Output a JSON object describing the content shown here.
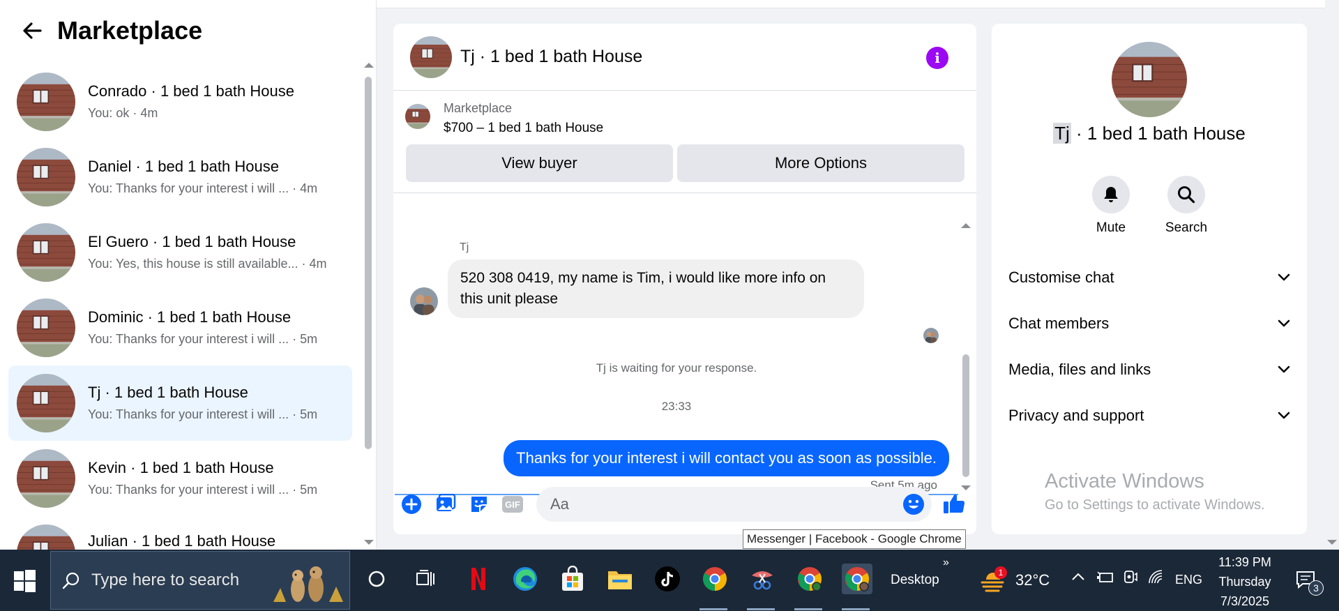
{
  "left": {
    "title": "Marketplace",
    "conversations": [
      {
        "name": "Conrado · 1 bed 1 bath House",
        "preview": "You: ok · 4m"
      },
      {
        "name": "Daniel · 1 bed 1 bath House",
        "preview": "You: Thanks for your interest i will ... · 4m"
      },
      {
        "name": "El Guero · 1 bed 1 bath House",
        "preview": "You: Yes, this house is still available... · 4m"
      },
      {
        "name": "Dominic · 1 bed 1 bath House",
        "preview": "You: Thanks for your interest i will ... · 5m"
      },
      {
        "name": "Tj · 1 bed 1 bath House",
        "preview": "You: Thanks for your interest i will ... · 5m",
        "active": true
      },
      {
        "name": "Kevin · 1 bed 1 bath House",
        "preview": "You: Thanks for your interest i will ... · 5m"
      },
      {
        "name": "Julian · 1 bed 1 bath House",
        "preview": ""
      }
    ]
  },
  "chat": {
    "title": "Tj · 1 bed 1 bath House",
    "listing_label": "Marketplace",
    "listing_price": "$700 – 1 bed 1 bath House",
    "view_buyer": "View buyer",
    "more_options": "More Options",
    "sender": "Tj",
    "incoming_message": "520 308 0419, my name is Tim, i would like more info on this unit please",
    "waiting": "Tj is waiting for your response.",
    "time": "23:33",
    "outgoing_message": "Thanks for your interest i will contact you as soon as possible.",
    "sent_status": "Sent 5m ago",
    "composer_placeholder": "Aa",
    "gif_label": "GIF"
  },
  "right": {
    "name_first": "Tj",
    "name_rest": " · 1 bed 1 bath House",
    "mute": "Mute",
    "search": "Search",
    "sections": [
      "Customise chat",
      "Chat members",
      "Media, files and links",
      "Privacy and support"
    ],
    "activate_title": "Activate Windows",
    "activate_sub": "Go to Settings to activate Windows."
  },
  "tooltip": "Messenger | Facebook - Google Chrome",
  "taskbar": {
    "search_placeholder": "Type here to search",
    "desktop": "Desktop",
    "weather_temp": "32°C",
    "weather_badge": "1",
    "language": "ENG",
    "time": "11:39 PM",
    "day": "Thursday",
    "date": "7/3/2025",
    "notifications": "3"
  },
  "colors": {
    "messenger_blue": "#0866ff",
    "info_purple": "#9b08f2",
    "active_conversation": "#ebf5ff",
    "taskbar": "#1b2838"
  }
}
